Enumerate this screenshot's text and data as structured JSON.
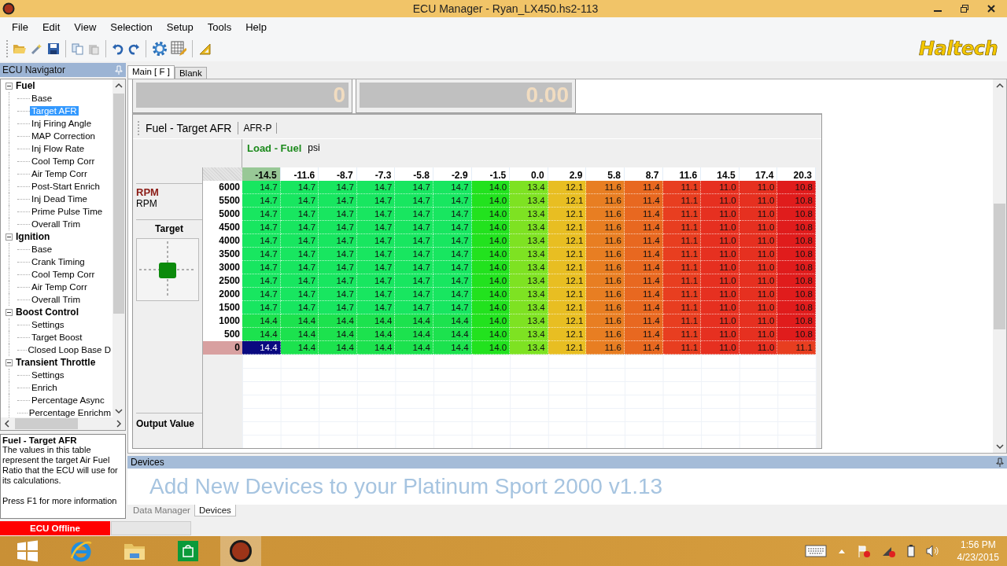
{
  "window": {
    "title": "ECU Manager - Ryan_LX450.hs2-113"
  },
  "menu": [
    "File",
    "Edit",
    "View",
    "Selection",
    "Setup",
    "Tools",
    "Help"
  ],
  "brand": "Haltech",
  "navigator": {
    "title": "ECU Navigator",
    "tree": [
      {
        "label": "Fuel",
        "expanded": true,
        "children": [
          {
            "label": "Base",
            "selected": false
          },
          {
            "label": "Target AFR",
            "selected": true
          },
          {
            "label": "Inj Firing Angle",
            "selected": false
          },
          {
            "label": "MAP Correction",
            "selected": false
          },
          {
            "label": "Inj Flow Rate",
            "selected": false
          },
          {
            "label": "Cool Temp Corr",
            "selected": false
          },
          {
            "label": "Air Temp Corr",
            "selected": false
          },
          {
            "label": "Post-Start Enrich",
            "selected": false
          },
          {
            "label": "Inj Dead Time",
            "selected": false
          },
          {
            "label": "Prime Pulse Time",
            "selected": false
          },
          {
            "label": "Overall Trim",
            "selected": false
          }
        ]
      },
      {
        "label": "Ignition",
        "expanded": true,
        "children": [
          {
            "label": "Base",
            "selected": false
          },
          {
            "label": "Crank Timing",
            "selected": false
          },
          {
            "label": "Cool Temp Corr",
            "selected": false
          },
          {
            "label": "Air Temp Corr",
            "selected": false
          },
          {
            "label": "Overall Trim",
            "selected": false
          }
        ]
      },
      {
        "label": "Boost Control",
        "expanded": true,
        "children": [
          {
            "label": "Settings",
            "selected": false
          },
          {
            "label": "Target Boost",
            "selected": false
          },
          {
            "label": "Closed Loop Base D",
            "selected": false
          }
        ]
      },
      {
        "label": "Transient Throttle",
        "expanded": true,
        "children": [
          {
            "label": "Settings",
            "selected": false
          },
          {
            "label": "Enrich",
            "selected": false
          },
          {
            "label": "Percentage Async",
            "selected": false
          },
          {
            "label": "Percentage Enrichm",
            "selected": false
          }
        ]
      }
    ]
  },
  "description": {
    "title": "Fuel - Target AFR",
    "body": "The values in this table represent the target Air Fuel Ratio that the ECU will use for its calculations.",
    "hint": "Press F1 for more information"
  },
  "tabs": [
    {
      "label": "Main [ F ]",
      "selected": true
    },
    {
      "label": "Blank",
      "selected": false
    }
  ],
  "gauges": [
    {
      "value": "0"
    },
    {
      "value": "0.00"
    }
  ],
  "table_view": {
    "title": "Fuel - Target AFR",
    "unit_tab": "AFR-P",
    "x_axis": {
      "name": "Load - Fuel",
      "unit": "psi"
    },
    "y_axis": {
      "name": "RPM",
      "unit": "RPM"
    },
    "target_label": "Target",
    "output_label": "Output Value",
    "columns": [
      {
        "label": "-14.5",
        "selected": true
      },
      {
        "label": "-11.6",
        "selected": false
      },
      {
        "label": "-8.7",
        "selected": false
      },
      {
        "label": "-7.3",
        "selected": false
      },
      {
        "label": "-5.8",
        "selected": false
      },
      {
        "label": "-2.9",
        "selected": false
      },
      {
        "label": "-1.5",
        "selected": false
      },
      {
        "label": "0.0",
        "selected": false
      },
      {
        "label": "2.9",
        "selected": false
      },
      {
        "label": "5.8",
        "selected": false
      },
      {
        "label": "8.7",
        "selected": false
      },
      {
        "label": "11.6",
        "selected": false
      },
      {
        "label": "14.5",
        "selected": false
      },
      {
        "label": "17.4",
        "selected": false
      },
      {
        "label": "20.3",
        "selected": false
      }
    ],
    "rows": [
      {
        "label": "6000",
        "selected": false,
        "cells": [
          "14.7",
          "14.7",
          "14.7",
          "14.7",
          "14.7",
          "14.7",
          "14.0",
          "13.4",
          "12.1",
          "11.6",
          "11.4",
          "11.1",
          "11.0",
          "11.0",
          "10.8"
        ]
      },
      {
        "label": "5500",
        "selected": false,
        "cells": [
          "14.7",
          "14.7",
          "14.7",
          "14.7",
          "14.7",
          "14.7",
          "14.0",
          "13.4",
          "12.1",
          "11.6",
          "11.4",
          "11.1",
          "11.0",
          "11.0",
          "10.8"
        ]
      },
      {
        "label": "5000",
        "selected": false,
        "cells": [
          "14.7",
          "14.7",
          "14.7",
          "14.7",
          "14.7",
          "14.7",
          "14.0",
          "13.4",
          "12.1",
          "11.6",
          "11.4",
          "11.1",
          "11.0",
          "11.0",
          "10.8"
        ]
      },
      {
        "label": "4500",
        "selected": false,
        "cells": [
          "14.7",
          "14.7",
          "14.7",
          "14.7",
          "14.7",
          "14.7",
          "14.0",
          "13.4",
          "12.1",
          "11.6",
          "11.4",
          "11.1",
          "11.0",
          "11.0",
          "10.8"
        ]
      },
      {
        "label": "4000",
        "selected": false,
        "cells": [
          "14.7",
          "14.7",
          "14.7",
          "14.7",
          "14.7",
          "14.7",
          "14.0",
          "13.4",
          "12.1",
          "11.6",
          "11.4",
          "11.1",
          "11.0",
          "11.0",
          "10.8"
        ]
      },
      {
        "label": "3500",
        "selected": false,
        "cells": [
          "14.7",
          "14.7",
          "14.7",
          "14.7",
          "14.7",
          "14.7",
          "14.0",
          "13.4",
          "12.1",
          "11.6",
          "11.4",
          "11.1",
          "11.0",
          "11.0",
          "10.8"
        ]
      },
      {
        "label": "3000",
        "selected": false,
        "cells": [
          "14.7",
          "14.7",
          "14.7",
          "14.7",
          "14.7",
          "14.7",
          "14.0",
          "13.4",
          "12.1",
          "11.6",
          "11.4",
          "11.1",
          "11.0",
          "11.0",
          "10.8"
        ]
      },
      {
        "label": "2500",
        "selected": false,
        "cells": [
          "14.7",
          "14.7",
          "14.7",
          "14.7",
          "14.7",
          "14.7",
          "14.0",
          "13.4",
          "12.1",
          "11.6",
          "11.4",
          "11.1",
          "11.0",
          "11.0",
          "10.8"
        ]
      },
      {
        "label": "2000",
        "selected": false,
        "cells": [
          "14.7",
          "14.7",
          "14.7",
          "14.7",
          "14.7",
          "14.7",
          "14.0",
          "13.4",
          "12.1",
          "11.6",
          "11.4",
          "11.1",
          "11.0",
          "11.0",
          "10.8"
        ]
      },
      {
        "label": "1500",
        "selected": false,
        "cells": [
          "14.7",
          "14.7",
          "14.7",
          "14.7",
          "14.7",
          "14.7",
          "14.0",
          "13.4",
          "12.1",
          "11.6",
          "11.4",
          "11.1",
          "11.0",
          "11.0",
          "10.8"
        ]
      },
      {
        "label": "1000",
        "selected": false,
        "cells": [
          "14.4",
          "14.4",
          "14.4",
          "14.4",
          "14.4",
          "14.4",
          "14.0",
          "13.4",
          "12.1",
          "11.6",
          "11.4",
          "11.1",
          "11.0",
          "11.0",
          "10.8"
        ]
      },
      {
        "label": "500",
        "selected": false,
        "cells": [
          "14.4",
          "14.4",
          "14.4",
          "14.4",
          "14.4",
          "14.4",
          "14.0",
          "13.4",
          "12.1",
          "11.6",
          "11.4",
          "11.1",
          "11.0",
          "11.0",
          "10.8"
        ]
      },
      {
        "label": "0",
        "selected": true,
        "cells": [
          "14.4",
          "14.4",
          "14.4",
          "14.4",
          "14.4",
          "14.4",
          "14.0",
          "13.4",
          "12.1",
          "11.6",
          "11.4",
          "11.1",
          "11.0",
          "11.0",
          "11.1"
        ]
      }
    ]
  },
  "devices": {
    "title": "Devices",
    "message": "Add New Devices to your Platinum Sport 2000 v1.13"
  },
  "bottom_tabs": [
    {
      "label": "Data Manager",
      "selected": false
    },
    {
      "label": "Devices",
      "selected": true
    }
  ],
  "status": {
    "text": "ECU Offline",
    "progress": {
      "level": 0
    }
  },
  "taskbar": {
    "time": "1:56 PM",
    "date": "4/23/2015"
  }
}
